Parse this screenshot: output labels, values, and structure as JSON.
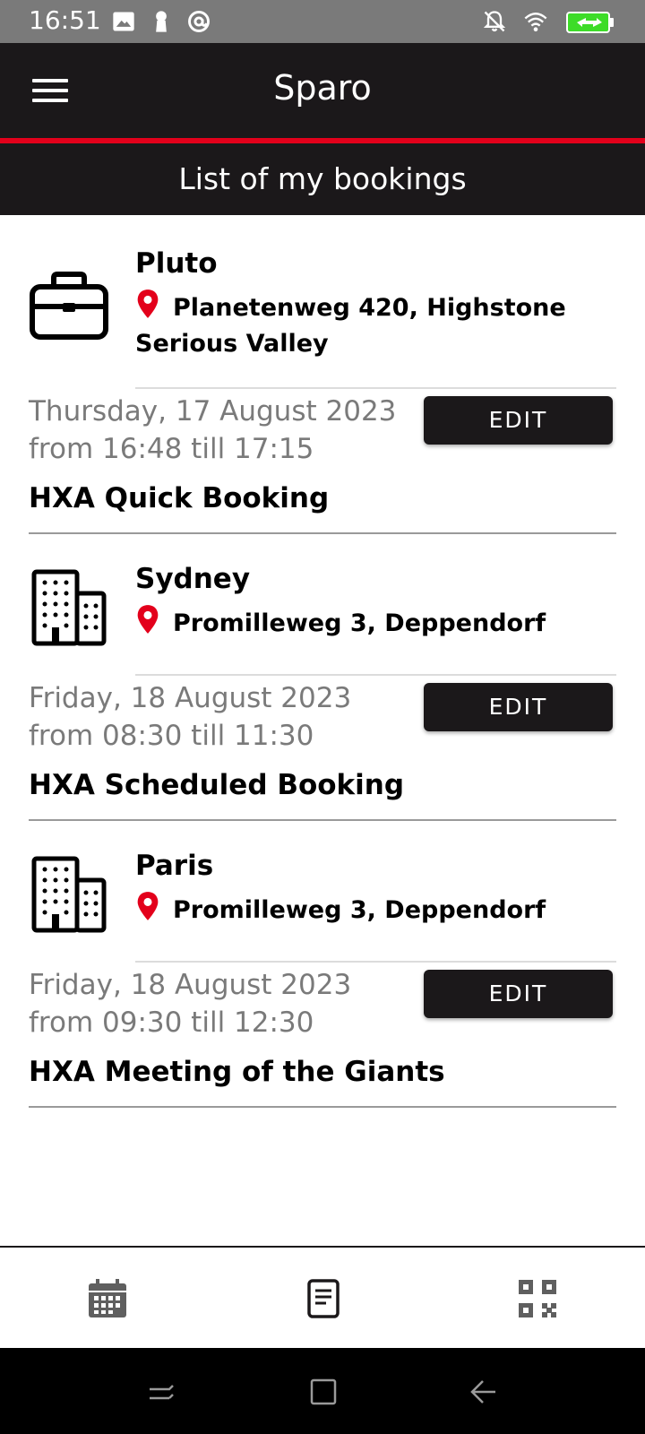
{
  "status_bar": {
    "time": "16:51",
    "left_icons": [
      "image-icon",
      "keyhole-icon",
      "at-sign-icon"
    ],
    "right_icons": [
      "notifications-off-icon",
      "wifi-icon",
      "battery-charging-icon"
    ],
    "battery_color": "#3ddc28"
  },
  "app_bar": {
    "title": "Sparo",
    "menu_icon": "hamburger-menu-icon"
  },
  "subheader": {
    "title": "List of my bookings"
  },
  "accent_color": "#e3001b",
  "dark_color": "#1b181a",
  "bookings": [
    {
      "icon": "briefcase-icon",
      "name": "Pluto",
      "address": "Planetenweg 420, Highstone Serious Valley",
      "date": "Thursday, 17 August 2023",
      "time": "from 16:48 till 17:15",
      "title": "HXA Quick Booking",
      "edit_label": "EDIT"
    },
    {
      "icon": "building-icon",
      "name": "Sydney",
      "address": "Promilleweg 3, Deppendorf",
      "date": "Friday, 18 August 2023",
      "time": "from 08:30 till 11:30",
      "title": "HXA Scheduled Booking",
      "edit_label": "EDIT"
    },
    {
      "icon": "building-icon",
      "name": "Paris",
      "address": "Promilleweg 3, Deppendorf",
      "date": "Friday, 18 August 2023",
      "time": "from 09:30 till 12:30",
      "title": "HXA Meeting of the Giants",
      "edit_label": "EDIT"
    }
  ],
  "bottom_nav": [
    {
      "icon": "calendar-icon",
      "active": false
    },
    {
      "icon": "bookings-list-icon",
      "active": true
    },
    {
      "icon": "qr-code-icon",
      "active": false
    }
  ],
  "system_nav": [
    "recents-icon",
    "home-icon",
    "back-icon"
  ]
}
